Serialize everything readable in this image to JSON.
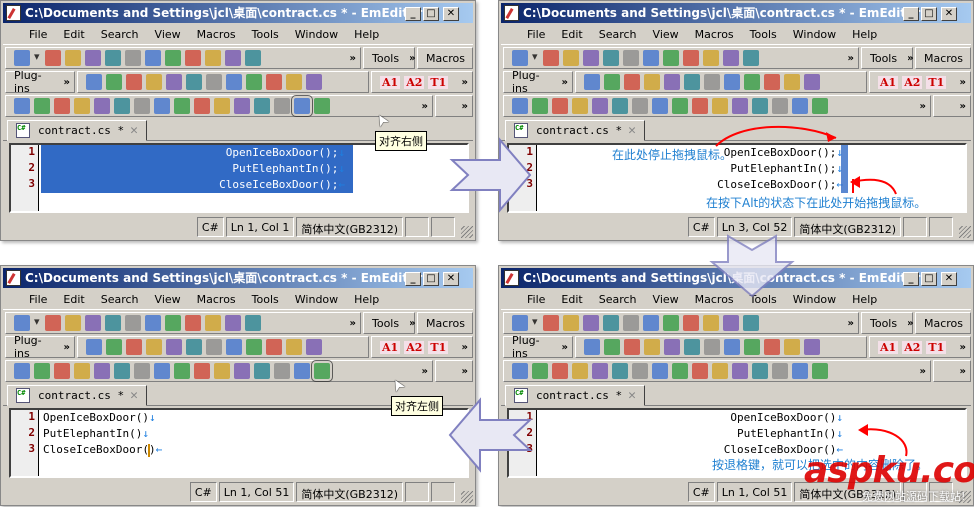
{
  "windows": [
    {
      "id": "tl",
      "title": "C:\\Documents and Settings\\jcl\\桌面\\contract.cs * - EmEditor",
      "tab": "contract.cs *",
      "align": "right",
      "selected": "all",
      "lines": [
        {
          "text": "OpenIceBoxDoor();",
          "mark": "↓"
        },
        {
          "text": "PutElephantIn();",
          "mark": "↓"
        },
        {
          "text": "CloseIceBoxDoor();",
          "mark": "←"
        }
      ],
      "status": {
        "lang": "C#",
        "pos": "Ln 1, Col 1",
        "encoding": "简体中文(GB2312)"
      },
      "tooltip": "对齐右侧",
      "active_button": "align-right"
    },
    {
      "id": "tr",
      "title": "C:\\Documents and Settings\\jcl\\桌面\\contract.cs * - EmEditor",
      "tab": "contract.cs *",
      "align": "right",
      "selected": "column",
      "lines": [
        {
          "text": "OpenIceBoxDoor();",
          "mark": "↓"
        },
        {
          "text": "PutElephantIn();",
          "mark": "↓"
        },
        {
          "text": "CloseIceBoxDoor();",
          "mark": "←"
        }
      ],
      "status": {
        "lang": "C#",
        "pos": "Ln 3, Col 52",
        "encoding": "简体中文(GB2312)"
      }
    },
    {
      "id": "bl",
      "title": "C:\\Documents and Settings\\jcl\\桌面\\contract.cs * - EmEditor",
      "tab": "contract.cs *",
      "align": "left",
      "selected": "none",
      "lines": [
        {
          "text": "OpenIceBoxDoor()",
          "mark": "↓"
        },
        {
          "text": "PutElephantIn()",
          "mark": "↓"
        },
        {
          "text": "CloseIceBoxDoor()",
          "mark": "←"
        }
      ],
      "status": {
        "lang": "C#",
        "pos": "Ln 1, Col 51",
        "encoding": "简体中文(GB2312)"
      },
      "tooltip": "对齐左侧",
      "active_button": "align-left"
    },
    {
      "id": "br",
      "title": "C:\\Documents and Settings\\jcl\\桌面\\contract.cs * - EmEditor",
      "tab": "contract.cs *",
      "align": "right",
      "selected": "none",
      "lines": [
        {
          "text": "OpenIceBoxDoor()",
          "mark": "↓"
        },
        {
          "text": "PutElephantIn()",
          "mark": "↓"
        },
        {
          "text": "CloseIceBoxDoor()",
          "mark": "←"
        }
      ],
      "status": {
        "lang": "C#",
        "pos": "Ln 1, Col 51",
        "encoding": "简体中文(GB2312)"
      }
    }
  ],
  "menu": [
    "File",
    "Edit",
    "Search",
    "View",
    "Macros",
    "Tools",
    "Window",
    "Help"
  ],
  "toolbars": {
    "tools_label": "Tools",
    "macros_label": "Macros",
    "plugins_label": "Plug-ins",
    "more": "»",
    "t1_icons": [
      "new-file",
      "dropdown",
      "open-folder",
      "save",
      "print",
      "print-preview",
      "cut",
      "copy",
      "paste",
      "undo",
      "redo",
      "find",
      "find-next"
    ],
    "t2_icons": [
      "insert",
      "comment",
      "uncomment",
      "comment-line",
      "delete",
      "indent",
      "outdent",
      "ruler",
      "split",
      "justify",
      "slash",
      "bracket"
    ],
    "t2_text_icons": [
      "A1",
      "A2",
      "T1"
    ],
    "t3_icons": [
      "doc-view",
      "list",
      "frame",
      "export",
      "swap-lines",
      "numbering",
      "paste-box",
      "sel-tool",
      "box-tool",
      "calendar",
      "info",
      "xml-check",
      "xml-magic",
      "palette",
      "align-right",
      "align-left"
    ]
  },
  "annotations": {
    "tr_stop": "在此处停止拖拽鼠标。",
    "tr_start": "在按下Alt的状态下在此处开始拖拽鼠标。",
    "br_delete": "按退格键，就可以把选中的内容删除了。"
  },
  "watermark": {
    "brand": "aspku.com",
    "slogan": "免费网站源码下载站!"
  },
  "colors": {
    "titlebar": "#0a246a",
    "selection": "#316ac5",
    "annotation": "#1e7fd0",
    "arrow_red": "#ff0000",
    "flow_arrow": "#8080c0"
  }
}
